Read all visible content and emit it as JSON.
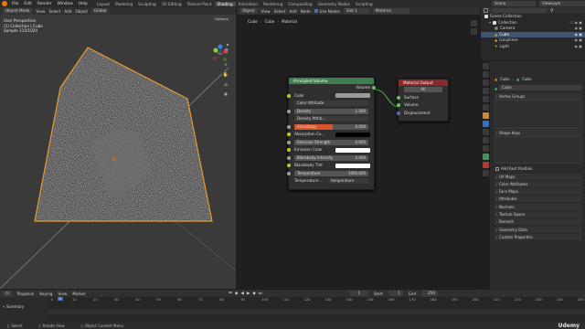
{
  "menubar": {
    "menus": [
      "File",
      "Edit",
      "Render",
      "Window",
      "Help"
    ],
    "workspaces": [
      "Layout",
      "Modeling",
      "Sculpting",
      "UV Editing",
      "Texture Paint",
      "Shading",
      "Animation",
      "Rendering",
      "Compositing",
      "Geometry Nodes",
      "Scripting"
    ],
    "active_workspace": "Shading",
    "scene": "Scene",
    "view_layer": "ViewLayer"
  },
  "viewport": {
    "header": {
      "mode": "Object Mode",
      "menus": [
        "View",
        "Select",
        "Add",
        "Object"
      ],
      "orientation": "Global"
    },
    "overlay_text": [
      "User Perspective",
      "(1) Collection | Cube",
      "Sample 115/1024"
    ],
    "options_label": "Options"
  },
  "node_editor": {
    "header": {
      "editor": "Object",
      "menus": [
        "View",
        "Select",
        "Add",
        "Node"
      ],
      "use_nodes": "Use Nodes",
      "slot": "Slot 1",
      "material": "Material"
    },
    "breadcrumb": [
      "Cube",
      "Cube",
      "Material"
    ],
    "principled_volume": {
      "title": "Principled Volume",
      "output": "Volume",
      "color_label": "Color",
      "color_attribute": "Color Attribute",
      "density_label": "Density",
      "density_value": "1.000",
      "density_attribute": "Density Attrib...",
      "anisotropy_label": "Anisotropy",
      "anisotropy_value": "0.000",
      "absorption_color": "Absorption Co...",
      "emission_strength_label": "Emission Strength",
      "emission_strength_value": "0.000",
      "emission_color": "Emission Color",
      "blackbody_intensity_label": "Blackbody Intensity",
      "blackbody_intensity_value": "0.000",
      "blackbody_tint": "Blackbody Tint",
      "temperature_label": "Temperature",
      "temperature_value": "1000.000",
      "temperature_attribute": "Temperature ...",
      "temperature_attribute_value": "temperature"
    },
    "material_output": {
      "title": "Material Output",
      "target": "All",
      "sockets": [
        "Surface",
        "Volume",
        "Displacement"
      ]
    }
  },
  "outliner": {
    "title": "Scene Collection",
    "items": [
      {
        "name": "Collection",
        "indent": 1
      },
      {
        "name": "Camera",
        "indent": 2
      },
      {
        "name": "Cube",
        "indent": 2
      },
      {
        "name": "Icosphere",
        "indent": 2
      },
      {
        "name": "Light",
        "indent": 2
      }
    ],
    "selected": "Cube"
  },
  "properties": {
    "breadcrumb": [
      "Cube",
      "Cube"
    ],
    "data_name": "Cube",
    "panels": [
      "Vertex Groups",
      "Shape Keys",
      "UV Maps",
      "Color Attributes",
      "Face Maps",
      "Attributes",
      "Normals",
      "Texture Space",
      "Remesh",
      "Geometry Data",
      "Custom Properties"
    ],
    "auto_relative": "Add Rest Position"
  },
  "timeline": {
    "menus": [
      "Playback",
      "Keying",
      "View",
      "Marker"
    ],
    "current_frame": "1",
    "start_label": "Start",
    "start_value": "1",
    "end_label": "End",
    "end_value": "250",
    "ticks": [
      "0",
      "10",
      "20",
      "30",
      "40",
      "50",
      "60",
      "70",
      "80",
      "90",
      "100",
      "110",
      "120",
      "130",
      "140",
      "150",
      "160",
      "170",
      "180",
      "190",
      "200",
      "210",
      "220",
      "230",
      "240",
      "250"
    ],
    "summary_label": "Summary"
  },
  "statusbar": {
    "items": [
      "Select",
      "Rotate View",
      "Object Context Menu"
    ],
    "watermark": "Udemy"
  },
  "colors": {
    "accent_orange": "#e87d0d",
    "selection_blue": "#4772b3",
    "node_header_shader": "#3f7f4f",
    "node_header_output": "#8a2b2b"
  }
}
